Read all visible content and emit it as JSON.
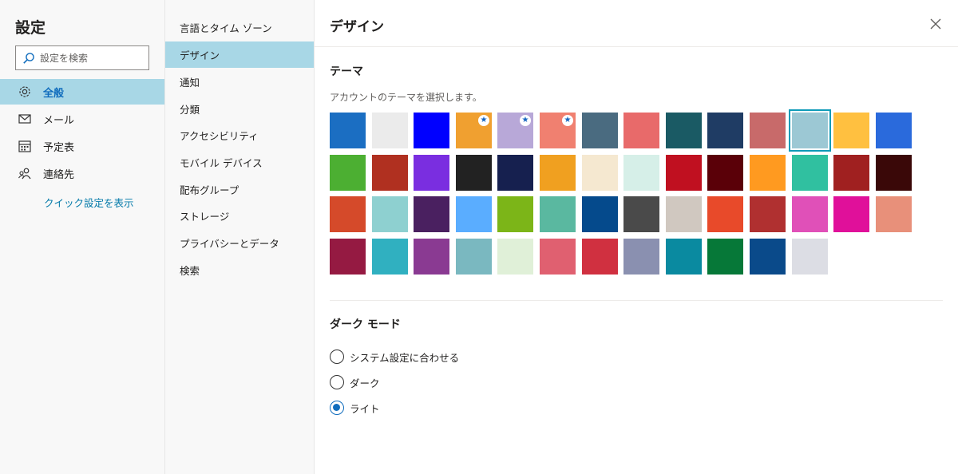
{
  "settings": {
    "title": "設定",
    "search_placeholder": "設定を検索",
    "nav": [
      {
        "label": "全般",
        "icon": "gear-icon",
        "active": true
      },
      {
        "label": "メール",
        "icon": "mail-icon",
        "active": false
      },
      {
        "label": "予定表",
        "icon": "calendar-icon",
        "active": false
      },
      {
        "label": "連絡先",
        "icon": "contacts-icon",
        "active": false
      }
    ],
    "quick_settings": "クイック設定を表示"
  },
  "general_nav": {
    "items": [
      {
        "label": "言語とタイム ゾーン",
        "active": false
      },
      {
        "label": "デザイン",
        "active": true
      },
      {
        "label": "通知",
        "active": false
      },
      {
        "label": "分類",
        "active": false
      },
      {
        "label": "アクセシビリティ",
        "active": false
      },
      {
        "label": "モバイル デバイス",
        "active": false
      },
      {
        "label": "配布グループ",
        "active": false
      },
      {
        "label": "ストレージ",
        "active": false
      },
      {
        "label": "プライバシーとデータ",
        "active": false
      },
      {
        "label": "検索",
        "active": false
      }
    ]
  },
  "design": {
    "page_title": "デザイン",
    "theme_section": "テーマ",
    "theme_description": "アカウントのテーマを選択します。",
    "selected_theme_index": 11,
    "starred_theme_indices": [
      3,
      4,
      5
    ],
    "themes": [
      "#1b6ec2",
      "#ebebeb",
      "#0000ff",
      "#f0a030",
      "#b8a8d8",
      "#f08070",
      "#4a6b80",
      "#e86a6a",
      "#1a5a64",
      "#1f3c64",
      "#c86a6a",
      "#9cc8d4",
      "#ffc040",
      "#2a6adc",
      "#4caf32",
      "#b03020",
      "#7a2ee0",
      "#222222",
      "#16204f",
      "#f0a020",
      "#f5e8d0",
      "#d6efe8",
      "#c01020",
      "#5a0008",
      "#ff9a20",
      "#30c0a0",
      "#a02020",
      "#3a0808",
      "#d54a2a",
      "#8ed0d0",
      "#4a2060",
      "#5aadff",
      "#7cb518",
      "#5ab8a0",
      "#054a8c",
      "#4a4a4a",
      "#d0c8c0",
      "#e84a2a",
      "#b03030",
      "#e050b8",
      "#e0109a",
      "#e8907a",
      "#951a42",
      "#30b0c0",
      "#8a3a92",
      "#7ab8c0",
      "#e0f0d8",
      "#e06070",
      "#d03040",
      "#8a90b0",
      "#0a8aa0",
      "#067838",
      "#0a4a8a",
      "#dcdde4"
    ],
    "dark_mode_section": "ダーク モード",
    "dark_mode_options": [
      {
        "label": "システム設定に合わせる",
        "checked": false
      },
      {
        "label": "ダーク",
        "checked": false
      },
      {
        "label": "ライト",
        "checked": true
      }
    ]
  }
}
